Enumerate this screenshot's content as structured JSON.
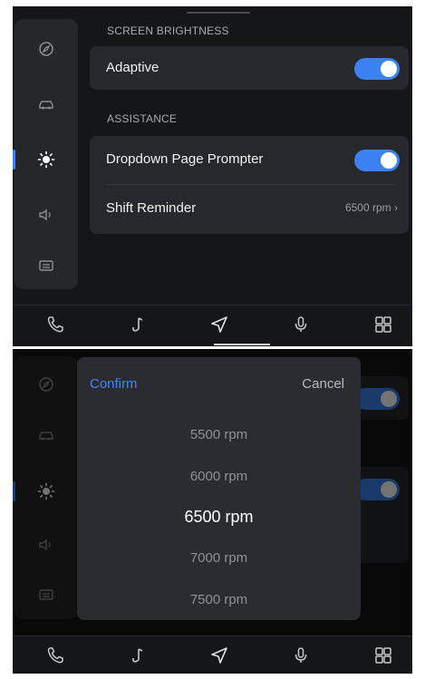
{
  "top": {
    "sections": {
      "brightness_label": "SCREEN BRIGHTNESS",
      "assistance_label": "ASSISTANCE"
    },
    "adaptive": {
      "label": "Adaptive",
      "on": true
    },
    "prompter": {
      "label": "Dropdown Page Prompter",
      "on": true
    },
    "shift_reminder": {
      "label": "Shift Reminder",
      "value": "6500 rpm"
    }
  },
  "picker": {
    "confirm_label": "Confirm",
    "cancel_label": "Cancel",
    "options": [
      "5500 rpm",
      "6000 rpm",
      "6500 rpm",
      "7000 rpm",
      "7500 rpm"
    ],
    "selected": "6500 rpm"
  },
  "colors": {
    "accent": "#3e84f0",
    "background": "#151618",
    "card": "#27282b"
  },
  "icons": {
    "rail": [
      "compass-icon",
      "car-icon",
      "brightness-icon",
      "speaker-icon",
      "keyboard-icon"
    ],
    "nav": [
      "phone-icon",
      "music-icon",
      "navigation-icon",
      "microphone-icon",
      "apps-grid-icon"
    ]
  }
}
